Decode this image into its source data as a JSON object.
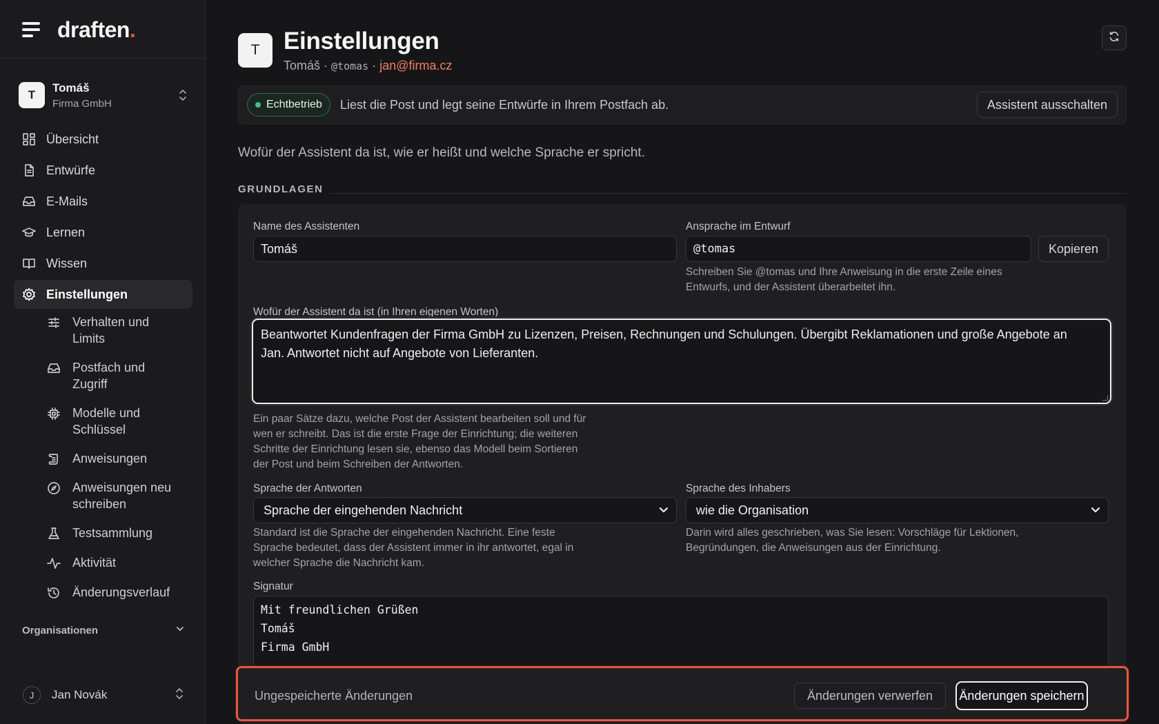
{
  "brand": {
    "name": "draften",
    "dot": "."
  },
  "account": {
    "initial": "T",
    "name": "Tomáš",
    "org": "Firma GmbH"
  },
  "nav": [
    {
      "label": "Übersicht",
      "icon": "dashboard-icon"
    },
    {
      "label": "Entwürfe",
      "icon": "document-icon"
    },
    {
      "label": "E-Mails",
      "icon": "inbox-icon"
    },
    {
      "label": "Lernen",
      "icon": "graduation-cap-icon"
    },
    {
      "label": "Wissen",
      "icon": "book-icon"
    },
    {
      "label": "Einstellungen",
      "icon": "gear-icon",
      "active": true
    }
  ],
  "subnav": [
    {
      "line1": "Verhalten und",
      "line2": "Limits",
      "icon": "sliders-icon"
    },
    {
      "line1": "Postfach und",
      "line2": "Zugriff",
      "icon": "inbox-icon"
    },
    {
      "line1": "Modelle und",
      "line2": "Schlüssel",
      "icon": "chip-icon"
    },
    {
      "line1": "Anweisungen",
      "line2": "",
      "icon": "scroll-icon"
    },
    {
      "line1": "Anweisungen neu",
      "line2": "schreiben",
      "icon": "compass-icon"
    },
    {
      "line1": "Testsammlung",
      "line2": "",
      "icon": "flask-icon"
    },
    {
      "line1": "Aktivität",
      "line2": "",
      "icon": "activity-icon"
    },
    {
      "line1": "Änderungsverlauf",
      "line2": "",
      "icon": "history-icon"
    }
  ],
  "sidebar_section": {
    "label": "Organisationen"
  },
  "user": {
    "initial": "J",
    "name": "Jan Novák"
  },
  "header": {
    "initial": "T",
    "title": "Einstellungen",
    "name": "Tomáš",
    "sep": " · ",
    "handle": "@tomas",
    "email": "jan@firma.cz"
  },
  "status": {
    "badge": "Echtbetrieb",
    "text": "Liest die Post und legt seine Entwürfe in Ihrem Postfach ab.",
    "button": "Assistent ausschalten",
    "color": "#46c08a"
  },
  "intro": "Wofür der Assistent da ist, wie er heißt und welche Sprache er spricht.",
  "section": "GRUNDLAGEN",
  "form": {
    "name_label": "Name des Assistenten",
    "name_value": "Tomáš",
    "address_label": "Ansprache im Entwurf",
    "address_value": "@tomas",
    "copy_button": "Kopieren",
    "address_hint_1": "Schreiben Sie @tomas und Ihre Anweisung in die erste Zeile eines",
    "address_hint_2": "Entwurfs, und der Assistent überarbeitet ihn.",
    "purpose_label": "Wofür der Assistent da ist (in Ihren eigenen Worten)",
    "purpose_line_1": "Beantwortet Kundenfragen der Firma GmbH zu Lizenzen, Preisen, Rechnungen und Schulungen. Übergibt Reklamationen und große Angebote an",
    "purpose_line_2": "Jan. Antwortet nicht auf Angebote von Lieferanten.",
    "purpose_hint_1": "Ein paar Sätze dazu, welche Post der Assistent bearbeiten soll und für",
    "purpose_hint_2": "wen er schreibt. Das ist die erste Frage der Einrichtung; die weiteren",
    "purpose_hint_3": "Schritte der Einrichtung lesen sie, ebenso das Modell beim Sortieren",
    "purpose_hint_4": "der Post und beim Schreiben der Antworten.",
    "reply_lang_label": "Sprache der Antworten",
    "reply_lang_value": "Sprache der eingehenden Nachricht",
    "reply_lang_hint_1": "Standard ist die Sprache der eingehenden Nachricht. Eine feste",
    "reply_lang_hint_2": "Sprache bedeutet, dass der Assistent immer in ihr antwortet, egal in",
    "reply_lang_hint_3": "welcher Sprache die Nachricht kam.",
    "owner_lang_label": "Sprache des Inhabers",
    "owner_lang_value": "wie die Organisation",
    "owner_lang_hint_1": "Darin wird alles geschrieben, was Sie lesen: Vorschläge für Lektionen,",
    "owner_lang_hint_2": "Begründungen, die Anweisungen aus der Einrichtung.",
    "signature_label": "Signatur",
    "signature_line_1": "Mit freundlichen Grüßen",
    "signature_line_2": "Tomáš",
    "signature_line_3": "Firma GmbH"
  },
  "savebar": {
    "text": "Ungespeicherte Änderungen",
    "discard": "Änderungen verwerfen",
    "save": "Änderungen speichern",
    "accent": "#e8553d"
  }
}
